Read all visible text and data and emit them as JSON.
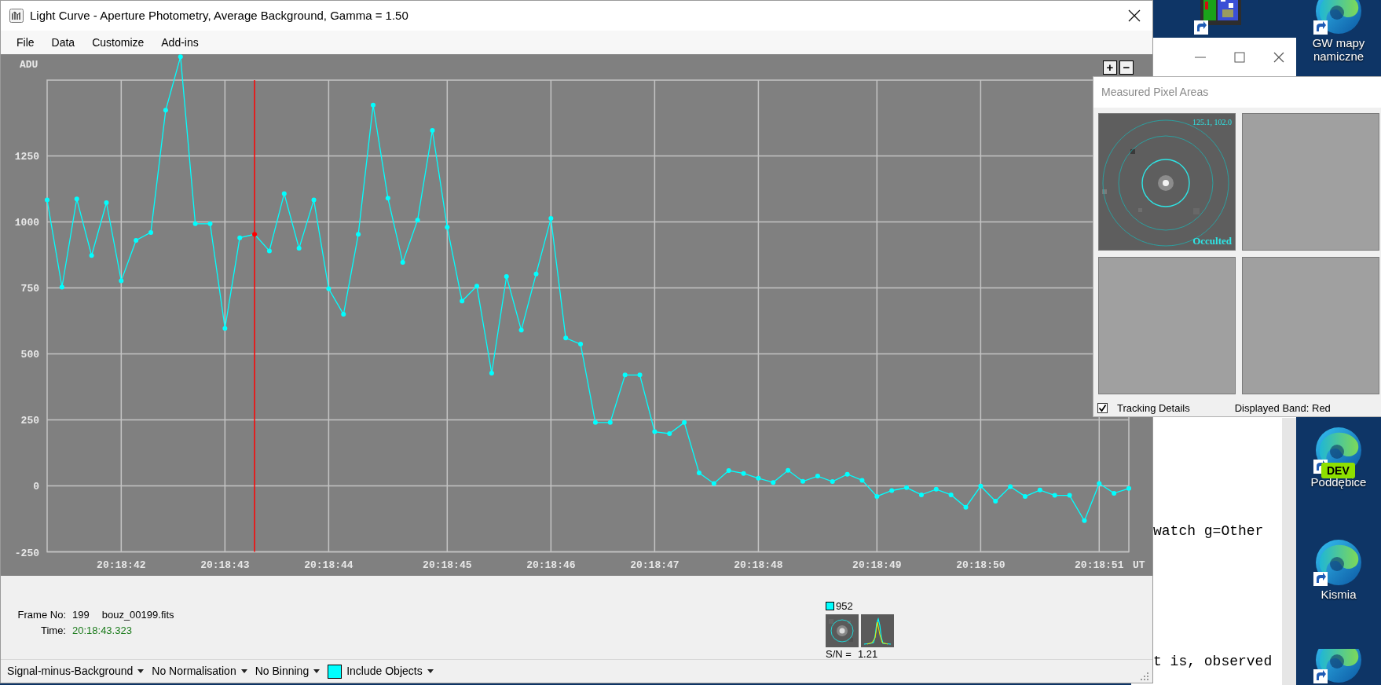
{
  "window": {
    "title": "Light Curve - Aperture Photometry, Average Background, Gamma = 1.50"
  },
  "menu": [
    "File",
    "Data",
    "Customize",
    "Add-ins"
  ],
  "zoom_buttons": [
    "+",
    "−"
  ],
  "chart": {
    "chart_data": {
      "type": "line",
      "ylabel": "ADU",
      "xlabel": "UT",
      "grid": true,
      "ylim": [
        -250,
        1630
      ],
      "categories": [
        null,
        null,
        null,
        null,
        null,
        "20:18:42",
        null,
        null,
        null,
        null,
        null,
        null,
        "20:18:43",
        null,
        null,
        null,
        null,
        null,
        null,
        "20:18:44",
        null,
        null,
        null,
        null,
        null,
        null,
        null,
        "20:18:45",
        null,
        null,
        null,
        null,
        null,
        null,
        "20:18:46",
        null,
        null,
        null,
        null,
        null,
        null,
        "20:18:47",
        null,
        null,
        null,
        null,
        null,
        null,
        "20:18:48",
        null,
        null,
        null,
        null,
        null,
        null,
        null,
        "20:18:49",
        null,
        null,
        null,
        null,
        null,
        null,
        "20:18:50",
        null,
        null,
        null,
        null,
        null,
        null,
        null,
        "20:18:51",
        null,
        null
      ],
      "yticks": [
        -250,
        0,
        250,
        500,
        750,
        1000,
        1250
      ],
      "series": [
        {
          "color": "#00ffff",
          "marker": "o",
          "values": [
            1083,
            753,
            1087,
            873,
            1073,
            777,
            930,
            960,
            1423,
            1626,
            993,
            993,
            597,
            940,
            953,
            890,
            1107,
            900,
            1083,
            747,
            650,
            953,
            1443,
            1090,
            847,
            1007,
            1347,
            980,
            700,
            757,
            427,
            793,
            590,
            803,
            1013,
            560,
            537,
            240,
            240,
            420,
            420,
            205,
            198,
            240,
            49,
            9,
            58,
            47,
            29,
            13,
            59,
            17,
            37,
            16,
            44,
            21,
            -40,
            -18,
            -7,
            -34,
            -13,
            -34,
            -81,
            -1,
            -58,
            -3,
            -40,
            -16,
            -36,
            -36,
            -132,
            9,
            -28,
            -10
          ]
        }
      ]
    },
    "points": [
      {
        "selected": false
      },
      {
        "selected": false
      },
      {
        "selected": false
      },
      {
        "selected": false
      },
      {
        "selected": false
      },
      {
        "selected": false
      },
      {
        "selected": false
      },
      {
        "selected": false
      },
      {
        "selected": false
      },
      {
        "selected": false
      },
      {
        "selected": false
      },
      {
        "selected": false
      },
      {
        "selected": false
      },
      {
        "selected": false
      },
      {
        "selected": true
      },
      {
        "selected": false
      },
      {
        "selected": false
      },
      {
        "selected": false
      },
      {
        "selected": false
      },
      {
        "selected": false
      },
      {
        "selected": false
      },
      {
        "selected": false
      },
      {
        "selected": false
      },
      {
        "selected": false
      },
      {
        "selected": false
      },
      {
        "selected": false
      },
      {
        "selected": false
      },
      {
        "selected": false
      },
      {
        "selected": false
      },
      {
        "selected": false
      },
      {
        "selected": false
      },
      {
        "selected": false
      },
      {
        "selected": false
      },
      {
        "selected": false
      },
      {
        "selected": false
      },
      {
        "selected": false
      },
      {
        "selected": false
      },
      {
        "selected": false
      },
      {
        "selected": false
      },
      {
        "selected": false
      },
      {
        "selected": false
      },
      {
        "selected": false
      },
      {
        "selected": false
      },
      {
        "selected": false
      },
      {
        "selected": false
      },
      {
        "selected": false
      },
      {
        "selected": false
      },
      {
        "selected": false
      },
      {
        "selected": false
      },
      {
        "selected": false
      },
      {
        "selected": false
      },
      {
        "selected": false
      },
      {
        "selected": false
      },
      {
        "selected": false
      },
      {
        "selected": false
      },
      {
        "selected": false
      },
      {
        "selected": false
      },
      {
        "selected": false
      },
      {
        "selected": false
      },
      {
        "selected": false
      },
      {
        "selected": false
      },
      {
        "selected": false
      },
      {
        "selected": false
      },
      {
        "selected": false
      },
      {
        "selected": false
      },
      {
        "selected": false
      },
      {
        "selected": false
      },
      {
        "selected": false
      },
      {
        "selected": false
      },
      {
        "selected": false
      },
      {
        "selected": false
      },
      {
        "selected": false
      },
      {
        "selected": false
      },
      {
        "selected": false
      }
    ]
  },
  "frame_info": {
    "frame_label": "Frame No:",
    "frame_number": "199",
    "file_name": "bouz_00199.fits",
    "time_label": "Time:",
    "time": "20:18:43.323"
  },
  "target": {
    "color": "#00ffff",
    "value": "952",
    "snr_label": "S/N =",
    "snr": "1.21"
  },
  "toolbar": [
    {
      "kind": "dropdown",
      "label": "Signal-minus-Background"
    },
    {
      "kind": "dropdown",
      "label": "No Normalisation"
    },
    {
      "kind": "dropdown",
      "label": "No Binning"
    },
    {
      "kind": "color-dropdown",
      "label": "Include Objects",
      "color": "#00ffff"
    }
  ],
  "pixel_areas": {
    "title": "Measured Pixel Areas",
    "tiles": [
      {
        "kind": "picture",
        "coords": "125.1, 102.0",
        "label": "Occulted"
      },
      {
        "kind": "empty"
      },
      {
        "kind": "empty"
      },
      {
        "kind": "empty"
      }
    ],
    "tracking_details": {
      "label": "Tracking Details",
      "checked": true
    },
    "band": "Displayed Band: Red"
  },
  "editor_lines": [
    "watch g=Other",
    "t is, observed"
  ],
  "desktop_icons": [
    {
      "kind": "mosaic"
    },
    {
      "kind": "swirl",
      "label": [
        "GW mapy",
        "namiczne"
      ]
    },
    {
      "kind": "swirl",
      "badge": "DEV",
      "label": [
        "Poddębice"
      ]
    },
    {
      "kind": "swirl",
      "label": [
        "Kismia"
      ]
    },
    {
      "kind": "swirl"
    }
  ]
}
